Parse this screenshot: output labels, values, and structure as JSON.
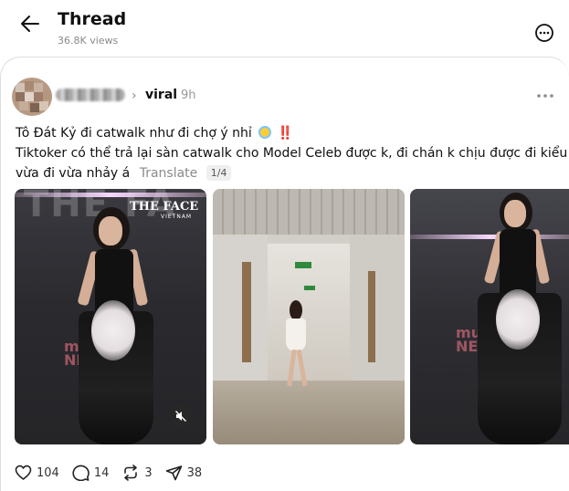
{
  "header": {
    "title": "Thread",
    "views": "36.8K views"
  },
  "post": {
    "community": "viral",
    "time": "9h",
    "line1": "Tô Đát Kỷ đi catwalk như đi chợ ý nhỉ",
    "line2": "Tiktoker có thể trả lại sàn catwalk cho Model Celeb được k, đi chán k chịu được đi kiểu",
    "line3": "vừa đi vừa nhảy á",
    "translate": "Translate",
    "page_count": "1/4",
    "bangs": "‼️",
    "media": {
      "brand": "THE FACE",
      "brand_sub": "VIETNAM",
      "wall_text": "THE FA",
      "watermark_line1": "multi",
      "watermark_line2": "NETWORK"
    }
  },
  "actions": {
    "likes": "104",
    "replies": "14",
    "reposts": "3",
    "shares": "38"
  },
  "icons": [
    "back-arrow-icon",
    "more-circle-icon",
    "chevron-right-icon",
    "more-horizontal-icon",
    "mute-icon",
    "heart-icon",
    "comment-icon",
    "repost-icon",
    "share-icon"
  ]
}
